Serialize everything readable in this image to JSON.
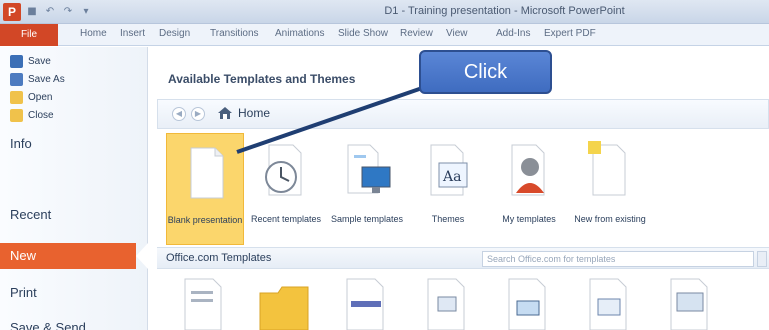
{
  "window": {
    "title": "D1 - Training presentation - Microsoft PowerPoint",
    "app_icon_letter": "P"
  },
  "ribbon": {
    "file_tab": "File",
    "tabs": [
      "Home",
      "Insert",
      "Design",
      "Transitions",
      "Animations",
      "Slide Show",
      "Review",
      "View",
      "Add-Ins",
      "Expert PDF"
    ]
  },
  "backstage": {
    "commands": [
      "Save",
      "Save As",
      "Open",
      "Close"
    ],
    "nav": [
      "Info",
      "Recent",
      "New",
      "Print",
      "Save & Send"
    ],
    "active_nav": "New"
  },
  "main": {
    "section_title": "Available Templates and Themes",
    "home_label": "Home",
    "templates": [
      {
        "label": "Blank presentation",
        "icon": "blank-page-icon",
        "selected": true
      },
      {
        "label": "Recent templates",
        "icon": "clock-icon",
        "selected": false
      },
      {
        "label": "Sample templates",
        "icon": "monitor-icon",
        "selected": false
      },
      {
        "label": "Themes",
        "icon": "font-aa-icon",
        "selected": false
      },
      {
        "label": "My templates",
        "icon": "person-icon",
        "selected": false
      },
      {
        "label": "New from existing",
        "icon": "sticky-note-icon",
        "selected": false
      }
    ],
    "office_com_title": "Office.com Templates",
    "search_placeholder": "Search Office.com for templates"
  },
  "callout": {
    "label": "Click"
  },
  "colors": {
    "accent": "#e8622f",
    "file_tab": "#d24726",
    "selection": "#fbd66c"
  }
}
